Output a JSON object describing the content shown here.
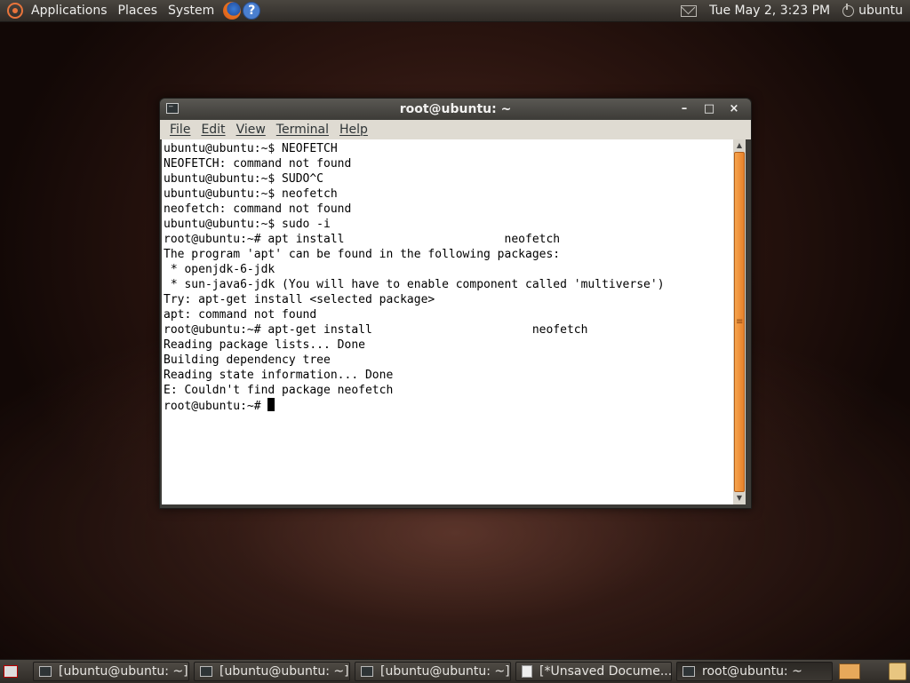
{
  "top_panel": {
    "applications": "Applications",
    "places": "Places",
    "system": "System",
    "clock": "Tue May  2,  3:23 PM",
    "user": "ubuntu"
  },
  "window": {
    "title": "root@ubuntu: ~",
    "menu": [
      "File",
      "Edit",
      "View",
      "Terminal",
      "Help"
    ],
    "buttons": {
      "minimize": "–",
      "maximize": "□",
      "close": "×"
    }
  },
  "terminal": {
    "lines": [
      "ubuntu@ubuntu:~$ NEOFETCH",
      "NEOFETCH: command not found",
      "ubuntu@ubuntu:~$ SUDO^C",
      "ubuntu@ubuntu:~$ neofetch",
      "neofetch: command not found",
      "ubuntu@ubuntu:~$ sudo -i",
      "root@ubuntu:~# apt install                       neofetch",
      "The program 'apt' can be found in the following packages:",
      " * openjdk-6-jdk",
      " * sun-java6-jdk (You will have to enable component called 'multiverse')",
      "Try: apt-get install <selected package>",
      "apt: command not found",
      "root@ubuntu:~# apt-get install                       neofetch",
      "Reading package lists... Done",
      "Building dependency tree",
      "Reading state information... Done",
      "E: Couldn't find package neofetch"
    ],
    "prompt": "root@ubuntu:~# "
  },
  "taskbar": {
    "tasks": [
      "[ubuntu@ubuntu: ~]",
      "[ubuntu@ubuntu: ~]",
      "[ubuntu@ubuntu: ~]",
      "[*Unsaved Docume...",
      "root@ubuntu: ~"
    ]
  },
  "colors": {
    "accent_orange": "#e8812a",
    "panel": "#3c3b37",
    "terminal_bg": "#ffffff"
  }
}
